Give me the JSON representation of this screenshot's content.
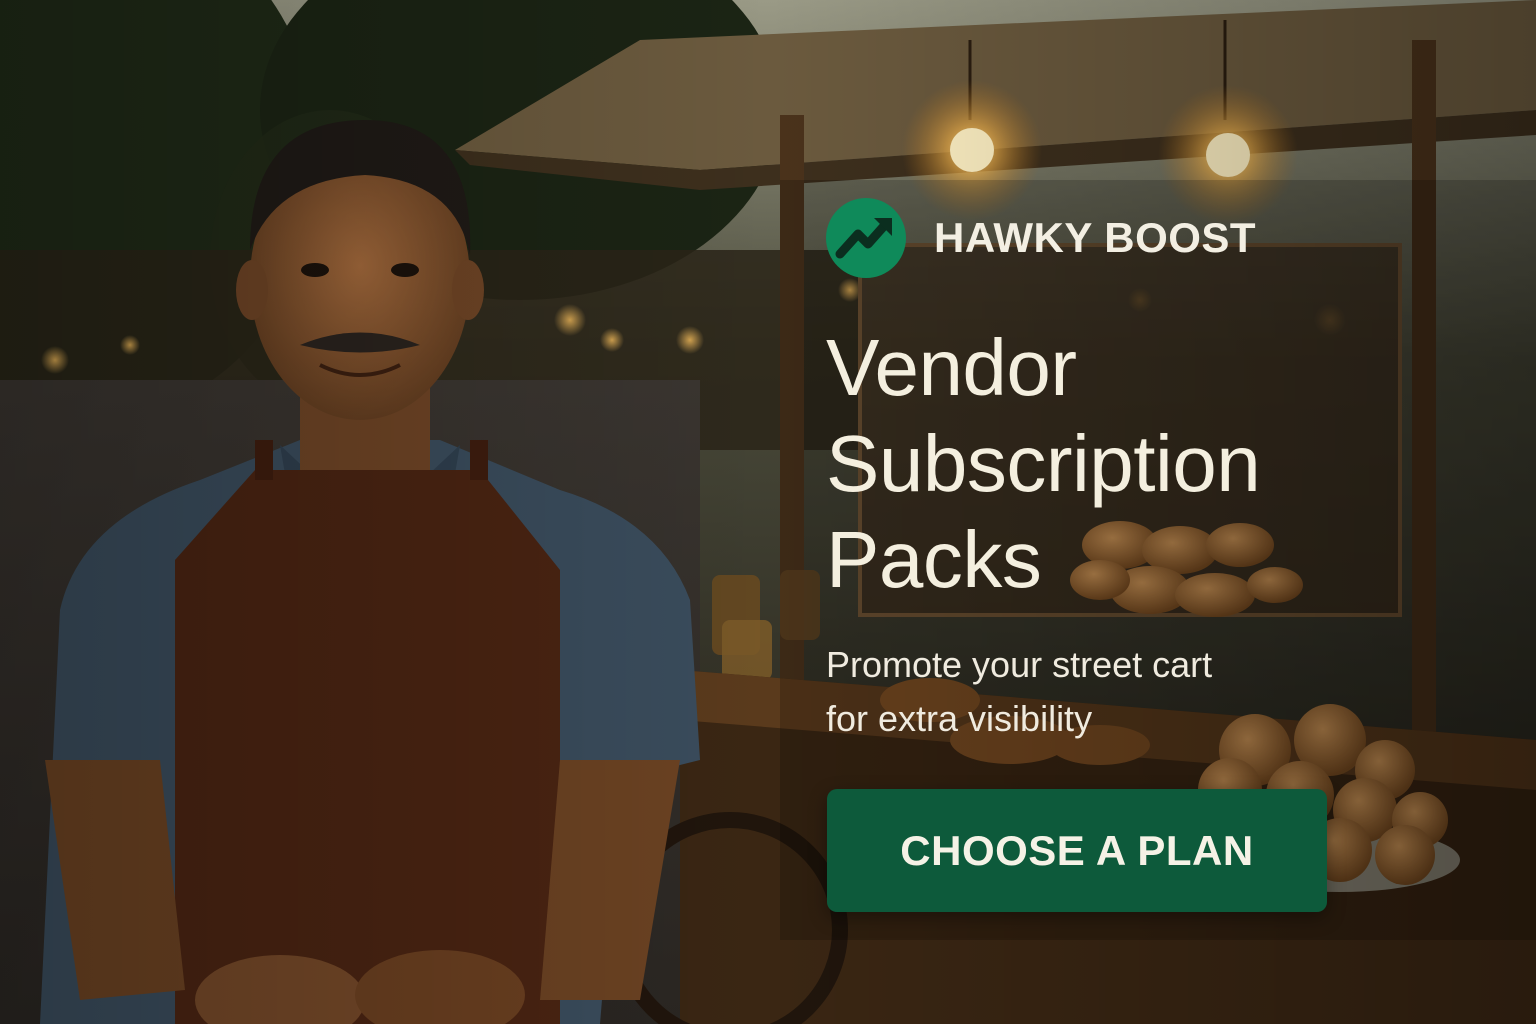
{
  "brand": {
    "name": "HAWKY BOOST",
    "icon": "trending-up-arrow-icon",
    "accent_color": "#0f8a5a"
  },
  "headline": {
    "line1": "Vendor",
    "line2": "Subscription",
    "line3": "Packs"
  },
  "subtitle": {
    "line1": "Promote your street cart",
    "line2": "for extra visibility"
  },
  "cta": {
    "label": "CHOOSE A PLAN",
    "color": "#0d5a3b"
  }
}
